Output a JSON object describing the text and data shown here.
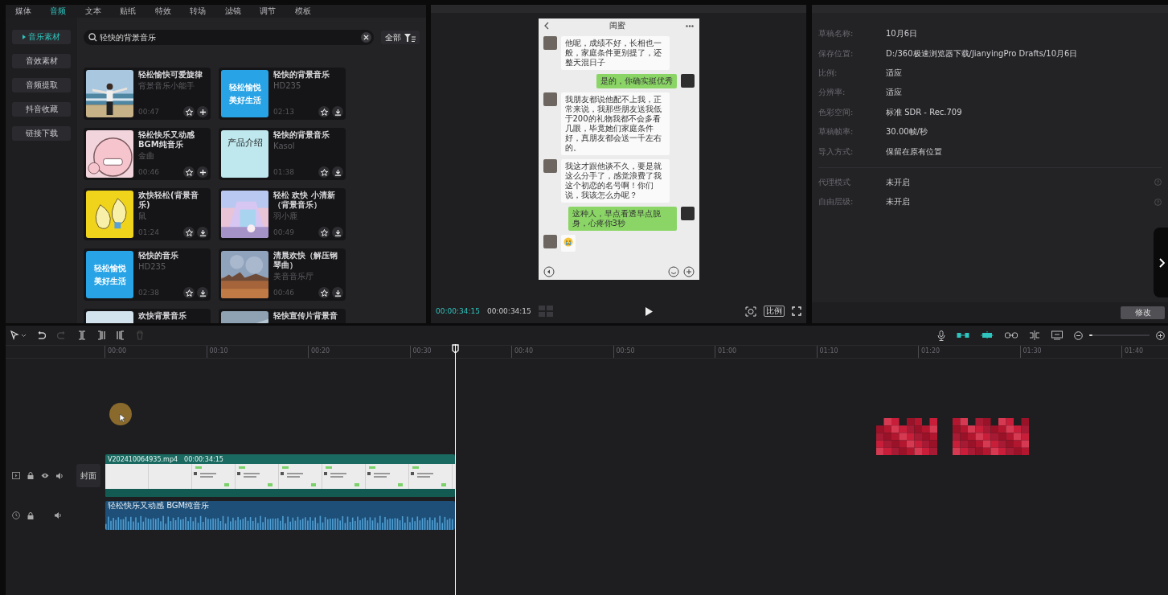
{
  "library": {
    "tabs": [
      {
        "label": "媒体",
        "selected": false
      },
      {
        "label": "音频",
        "selected": true
      },
      {
        "label": "文本",
        "selected": false
      },
      {
        "label": "贴纸",
        "selected": false
      },
      {
        "label": "特效",
        "selected": false
      },
      {
        "label": "转场",
        "selected": false
      },
      {
        "label": "滤镜",
        "selected": false
      },
      {
        "label": "调节",
        "selected": false
      },
      {
        "label": "模板",
        "selected": false
      }
    ],
    "categories": [
      {
        "label": "音乐素材",
        "selected": true
      },
      {
        "label": "音效素材",
        "selected": false
      },
      {
        "label": "音频提取",
        "selected": false
      },
      {
        "label": "抖音收藏",
        "selected": false
      },
      {
        "label": "链接下载",
        "selected": false
      }
    ],
    "search": {
      "value": "轻快的背景音乐"
    },
    "filter": {
      "label": "全部"
    },
    "tracks": [
      {
        "title": "轻松愉快可爱旋律",
        "artist": "背景音乐小能手",
        "duration": "00:47",
        "action": {
          "kind": "add"
        }
      },
      {
        "title": "轻快的背景音乐",
        "artist": "HD235",
        "duration": "02:13",
        "action": {
          "kind": "download"
        },
        "thumb": {
          "kind": "cover",
          "color": "#27a3e6",
          "lines": [
            "轻松愉悦",
            "美好生活"
          ]
        }
      },
      {
        "title": "轻松快乐又动感BGM纯音乐",
        "artist": "金曲",
        "duration": "00:46",
        "action": {
          "kind": "add"
        }
      },
      {
        "title": "轻快的背景音乐",
        "artist": "Kasol",
        "duration": "01:38",
        "action": {
          "kind": "download"
        },
        "thumb": {
          "kind": "cover",
          "color": "#bfe8ee",
          "lines": [
            "产品介绍"
          ]
        }
      },
      {
        "title": "欢快轻松(背景音乐)",
        "artist": "鼠",
        "duration": "01:24",
        "action": {
          "kind": "download"
        }
      },
      {
        "title": "轻松 欢快 小清新（背景音乐）",
        "artist": "羽小鹿",
        "duration": "00:49",
        "action": {
          "kind": "download"
        }
      },
      {
        "title": "轻快的音乐",
        "artist": "HD235",
        "duration": "02:38",
        "action": {
          "kind": "download"
        },
        "thumb": {
          "kind": "cover",
          "color": "#27a3e6",
          "lines": [
            "轻松愉悦",
            "美好生活"
          ]
        }
      },
      {
        "title": "清晨欢快（解压钢琴曲）",
        "artist": "美音音乐厅",
        "duration": "00:46",
        "action": {
          "kind": "download"
        }
      },
      {
        "title": "欢快背景音乐"
      },
      {
        "title": "轻快宣传片背景音"
      }
    ]
  },
  "player": {
    "phone": {
      "title": "闺蜜",
      "messages": [
        {
          "kind": "incoming",
          "text": "他呢，成绩不好，长相也一般，家庭条件更别提了，还整天混日子"
        },
        {
          "kind": "outgoing",
          "text": "是的，你确实挺优秀"
        },
        {
          "kind": "incoming",
          "text": "我朋友都说他配不上我，正常来说，我那些朋友送我低于200的礼物我都不会多看几眼，毕竟她们家庭条件好，真朋友都会送一千左右的。"
        },
        {
          "kind": "incoming",
          "text": "我这才跟他谈不久，要是就这么分手了，感觉浪费了我这个初恋的名号啊！你们说，我该怎么办呢？"
        },
        {
          "kind": "outgoing",
          "text": "这种人，早点看透早点脱身，心疼你3秒"
        },
        {
          "kind": "incoming-emoji"
        }
      ]
    },
    "current_time": "00:00:34:15",
    "total_time": "00:00:34:15",
    "ratio_button": "比例"
  },
  "draft": {
    "fields": [
      {
        "label": "草稿名称:",
        "value": "10月6日"
      },
      {
        "label": "保存位置:",
        "value": "D:/360极速浏览器下载/JianyingPro Drafts/10月6日"
      },
      {
        "label": "比例:",
        "value": "适应"
      },
      {
        "label": "分辨率:",
        "value": "适应"
      },
      {
        "label": "色彩空间:",
        "value": "标准 SDR - Rec.709"
      },
      {
        "label": "草稿帧率:",
        "value": "30.00帧/秒"
      },
      {
        "label": "导入方式:",
        "value": "保留在原有位置"
      }
    ],
    "extra_fields": [
      {
        "label": "代理模式",
        "value": "未开启"
      },
      {
        "label": "自由层级:",
        "value": "未开启"
      }
    ],
    "edit_button": "修改"
  },
  "timeline": {
    "tools": [
      {
        "kind": "select"
      },
      {
        "kind": "undo",
        "disabled": false
      },
      {
        "kind": "redo",
        "disabled": true
      },
      {
        "kind": "split",
        "disabled": false
      },
      {
        "kind": "split-left",
        "disabled": false
      },
      {
        "kind": "split-right",
        "disabled": false
      },
      {
        "kind": "delete",
        "disabled": true
      }
    ],
    "right_tools": [
      {
        "kind": "mic",
        "on": false
      },
      {
        "kind": "main-link",
        "on": true
      },
      {
        "kind": "preview-axis",
        "on": true
      },
      {
        "kind": "link",
        "on": false
      },
      {
        "kind": "split-preview",
        "on": false
      },
      {
        "kind": "preview",
        "on": false
      }
    ],
    "zoom": {
      "level": 0.05
    },
    "ruler": [
      "00:00",
      "00:10",
      "00:20",
      "00:30",
      "00:40",
      "00:50",
      "01:00",
      "01:10",
      "01:20",
      "01:30",
      "01:40"
    ],
    "cover_button": "封面",
    "video_clip": {
      "name": "V202410064935.mp4",
      "duration": "00:00:34:15"
    },
    "audio_clip": {
      "name": "轻松快乐又动感 BGM纯音乐"
    }
  }
}
